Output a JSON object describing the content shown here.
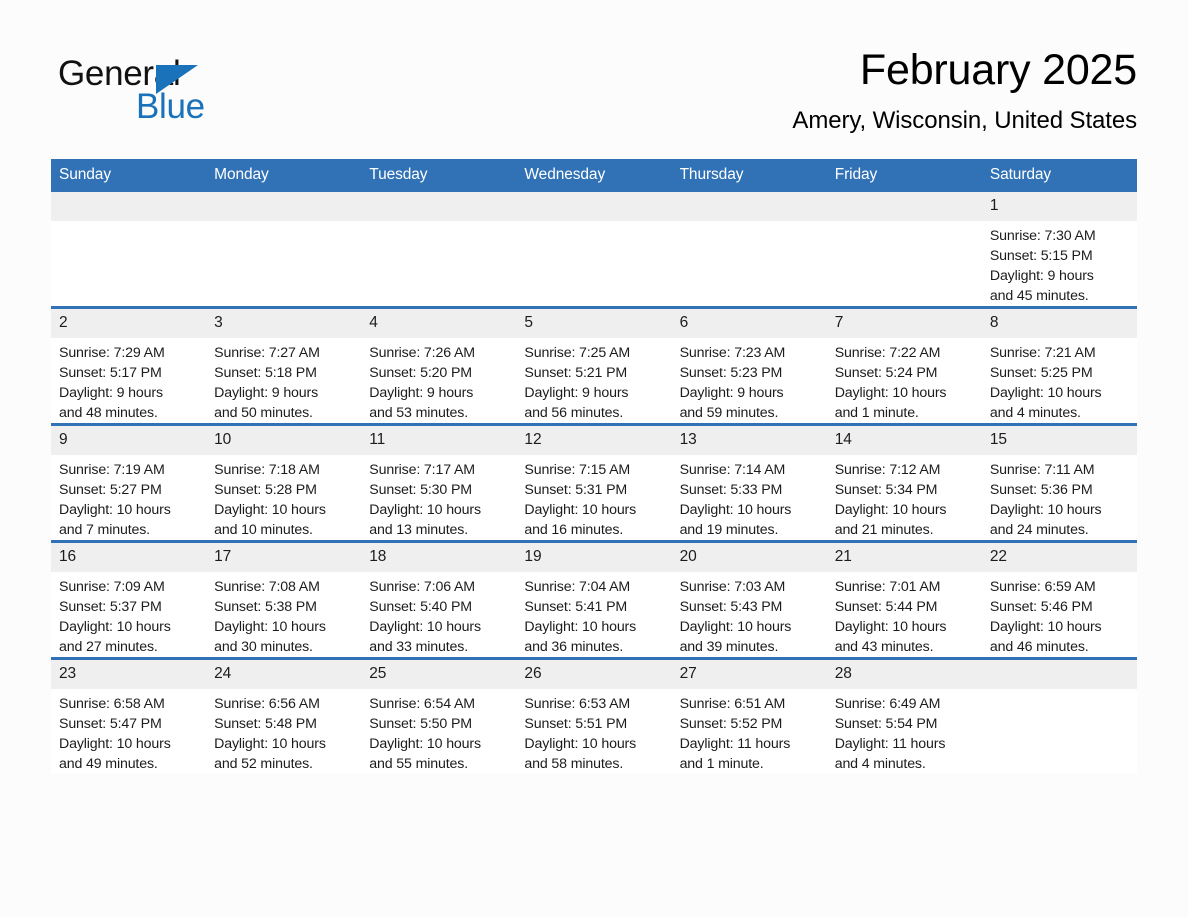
{
  "brand": {
    "name_part1": "General",
    "name_part2": "Blue",
    "accent_color": "#1a72ba"
  },
  "header": {
    "title": "February 2025",
    "subtitle": "Amery, Wisconsin, United States"
  },
  "theme": {
    "header_blue": "#3072b5",
    "daynum_band": "#efefef",
    "page_background": "#fcfcfc",
    "text": "#1c1c1c"
  },
  "weekdays": [
    "Sunday",
    "Monday",
    "Tuesday",
    "Wednesday",
    "Thursday",
    "Friday",
    "Saturday"
  ],
  "weeks": [
    [
      {
        "day": "",
        "blank": true,
        "sunrise": "",
        "sunset": "",
        "daylight1": "",
        "daylight2": ""
      },
      {
        "day": "",
        "blank": true,
        "sunrise": "",
        "sunset": "",
        "daylight1": "",
        "daylight2": ""
      },
      {
        "day": "",
        "blank": true,
        "sunrise": "",
        "sunset": "",
        "daylight1": "",
        "daylight2": ""
      },
      {
        "day": "",
        "blank": true,
        "sunrise": "",
        "sunset": "",
        "daylight1": "",
        "daylight2": ""
      },
      {
        "day": "",
        "blank": true,
        "sunrise": "",
        "sunset": "",
        "daylight1": "",
        "daylight2": ""
      },
      {
        "day": "",
        "blank": true,
        "sunrise": "",
        "sunset": "",
        "daylight1": "",
        "daylight2": ""
      },
      {
        "day": "1",
        "blank": false,
        "sunrise": "Sunrise: 7:30 AM",
        "sunset": "Sunset: 5:15 PM",
        "daylight1": "Daylight: 9 hours",
        "daylight2": "and 45 minutes."
      }
    ],
    [
      {
        "day": "2",
        "blank": false,
        "sunrise": "Sunrise: 7:29 AM",
        "sunset": "Sunset: 5:17 PM",
        "daylight1": "Daylight: 9 hours",
        "daylight2": "and 48 minutes."
      },
      {
        "day": "3",
        "blank": false,
        "sunrise": "Sunrise: 7:27 AM",
        "sunset": "Sunset: 5:18 PM",
        "daylight1": "Daylight: 9 hours",
        "daylight2": "and 50 minutes."
      },
      {
        "day": "4",
        "blank": false,
        "sunrise": "Sunrise: 7:26 AM",
        "sunset": "Sunset: 5:20 PM",
        "daylight1": "Daylight: 9 hours",
        "daylight2": "and 53 minutes."
      },
      {
        "day": "5",
        "blank": false,
        "sunrise": "Sunrise: 7:25 AM",
        "sunset": "Sunset: 5:21 PM",
        "daylight1": "Daylight: 9 hours",
        "daylight2": "and 56 minutes."
      },
      {
        "day": "6",
        "blank": false,
        "sunrise": "Sunrise: 7:23 AM",
        "sunset": "Sunset: 5:23 PM",
        "daylight1": "Daylight: 9 hours",
        "daylight2": "and 59 minutes."
      },
      {
        "day": "7",
        "blank": false,
        "sunrise": "Sunrise: 7:22 AM",
        "sunset": "Sunset: 5:24 PM",
        "daylight1": "Daylight: 10 hours",
        "daylight2": "and 1 minute."
      },
      {
        "day": "8",
        "blank": false,
        "sunrise": "Sunrise: 7:21 AM",
        "sunset": "Sunset: 5:25 PM",
        "daylight1": "Daylight: 10 hours",
        "daylight2": "and 4 minutes."
      }
    ],
    [
      {
        "day": "9",
        "blank": false,
        "sunrise": "Sunrise: 7:19 AM",
        "sunset": "Sunset: 5:27 PM",
        "daylight1": "Daylight: 10 hours",
        "daylight2": "and 7 minutes."
      },
      {
        "day": "10",
        "blank": false,
        "sunrise": "Sunrise: 7:18 AM",
        "sunset": "Sunset: 5:28 PM",
        "daylight1": "Daylight: 10 hours",
        "daylight2": "and 10 minutes."
      },
      {
        "day": "11",
        "blank": false,
        "sunrise": "Sunrise: 7:17 AM",
        "sunset": "Sunset: 5:30 PM",
        "daylight1": "Daylight: 10 hours",
        "daylight2": "and 13 minutes."
      },
      {
        "day": "12",
        "blank": false,
        "sunrise": "Sunrise: 7:15 AM",
        "sunset": "Sunset: 5:31 PM",
        "daylight1": "Daylight: 10 hours",
        "daylight2": "and 16 minutes."
      },
      {
        "day": "13",
        "blank": false,
        "sunrise": "Sunrise: 7:14 AM",
        "sunset": "Sunset: 5:33 PM",
        "daylight1": "Daylight: 10 hours",
        "daylight2": "and 19 minutes."
      },
      {
        "day": "14",
        "blank": false,
        "sunrise": "Sunrise: 7:12 AM",
        "sunset": "Sunset: 5:34 PM",
        "daylight1": "Daylight: 10 hours",
        "daylight2": "and 21 minutes."
      },
      {
        "day": "15",
        "blank": false,
        "sunrise": "Sunrise: 7:11 AM",
        "sunset": "Sunset: 5:36 PM",
        "daylight1": "Daylight: 10 hours",
        "daylight2": "and 24 minutes."
      }
    ],
    [
      {
        "day": "16",
        "blank": false,
        "sunrise": "Sunrise: 7:09 AM",
        "sunset": "Sunset: 5:37 PM",
        "daylight1": "Daylight: 10 hours",
        "daylight2": "and 27 minutes."
      },
      {
        "day": "17",
        "blank": false,
        "sunrise": "Sunrise: 7:08 AM",
        "sunset": "Sunset: 5:38 PM",
        "daylight1": "Daylight: 10 hours",
        "daylight2": "and 30 minutes."
      },
      {
        "day": "18",
        "blank": false,
        "sunrise": "Sunrise: 7:06 AM",
        "sunset": "Sunset: 5:40 PM",
        "daylight1": "Daylight: 10 hours",
        "daylight2": "and 33 minutes."
      },
      {
        "day": "19",
        "blank": false,
        "sunrise": "Sunrise: 7:04 AM",
        "sunset": "Sunset: 5:41 PM",
        "daylight1": "Daylight: 10 hours",
        "daylight2": "and 36 minutes."
      },
      {
        "day": "20",
        "blank": false,
        "sunrise": "Sunrise: 7:03 AM",
        "sunset": "Sunset: 5:43 PM",
        "daylight1": "Daylight: 10 hours",
        "daylight2": "and 39 minutes."
      },
      {
        "day": "21",
        "blank": false,
        "sunrise": "Sunrise: 7:01 AM",
        "sunset": "Sunset: 5:44 PM",
        "daylight1": "Daylight: 10 hours",
        "daylight2": "and 43 minutes."
      },
      {
        "day": "22",
        "blank": false,
        "sunrise": "Sunrise: 6:59 AM",
        "sunset": "Sunset: 5:46 PM",
        "daylight1": "Daylight: 10 hours",
        "daylight2": "and 46 minutes."
      }
    ],
    [
      {
        "day": "23",
        "blank": false,
        "sunrise": "Sunrise: 6:58 AM",
        "sunset": "Sunset: 5:47 PM",
        "daylight1": "Daylight: 10 hours",
        "daylight2": "and 49 minutes."
      },
      {
        "day": "24",
        "blank": false,
        "sunrise": "Sunrise: 6:56 AM",
        "sunset": "Sunset: 5:48 PM",
        "daylight1": "Daylight: 10 hours",
        "daylight2": "and 52 minutes."
      },
      {
        "day": "25",
        "blank": false,
        "sunrise": "Sunrise: 6:54 AM",
        "sunset": "Sunset: 5:50 PM",
        "daylight1": "Daylight: 10 hours",
        "daylight2": "and 55 minutes."
      },
      {
        "day": "26",
        "blank": false,
        "sunrise": "Sunrise: 6:53 AM",
        "sunset": "Sunset: 5:51 PM",
        "daylight1": "Daylight: 10 hours",
        "daylight2": "and 58 minutes."
      },
      {
        "day": "27",
        "blank": false,
        "sunrise": "Sunrise: 6:51 AM",
        "sunset": "Sunset: 5:52 PM",
        "daylight1": "Daylight: 11 hours",
        "daylight2": "and 1 minute."
      },
      {
        "day": "28",
        "blank": false,
        "sunrise": "Sunrise: 6:49 AM",
        "sunset": "Sunset: 5:54 PM",
        "daylight1": "Daylight: 11 hours",
        "daylight2": "and 4 minutes."
      },
      {
        "day": "",
        "blank": true,
        "sunrise": "",
        "sunset": "",
        "daylight1": "",
        "daylight2": ""
      }
    ]
  ]
}
